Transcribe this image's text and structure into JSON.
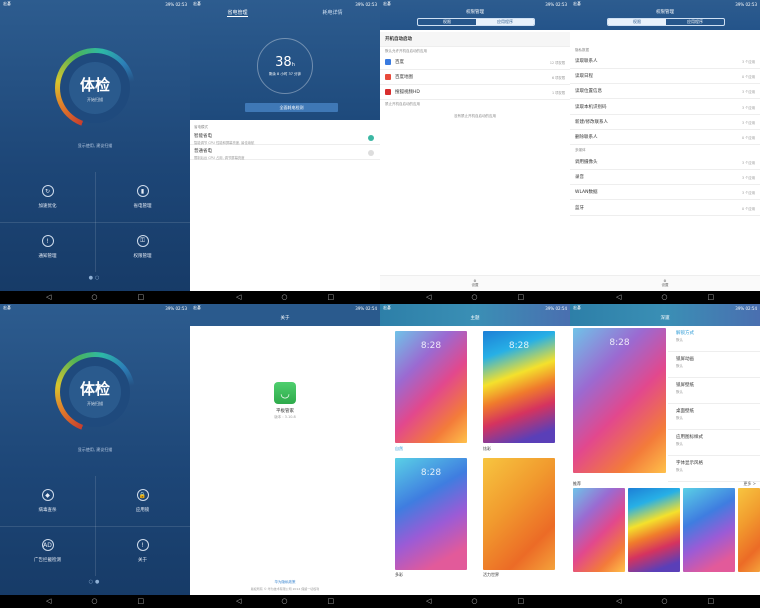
{
  "status": {
    "time": "02:53",
    "time2": "02:54",
    "carrier": "宏碁",
    "battery": "39%"
  },
  "home1": {
    "title": "体检",
    "subtitle": "开始扫描",
    "hint": "显示使用, 建议扫描",
    "items": [
      {
        "label": "加速优化",
        "icon": "↻"
      },
      {
        "label": "省电管理",
        "icon": "▮"
      },
      {
        "label": "通知管理",
        "icon": "!"
      },
      {
        "label": "权限管理",
        "icon": "⚿"
      }
    ]
  },
  "home2": {
    "title": "体检",
    "subtitle": "开始扫描",
    "hint": "显示使用, 建议扫描",
    "items": [
      {
        "label": "病毒查杀",
        "icon": "◆"
      },
      {
        "label": "应用锁",
        "icon": "🔒"
      },
      {
        "label": "广告拦截检测",
        "icon": "AD"
      },
      {
        "label": "关于",
        "icon": "!"
      }
    ]
  },
  "power": {
    "tab1": "省电管理",
    "tab2": "耗电详情",
    "hours": "38",
    "unit": "h",
    "remain": "剩余 8 小时 37 分钟",
    "button": "全面耗电检测",
    "modes_header": "省电模式",
    "modes": [
      {
        "name": "智能省电",
        "detail": "智能调节 CPU 性能和屏幕亮度, 最佳续航"
      },
      {
        "name": "普通省电",
        "detail": "限制后台 CPU 占用, 调节屏幕亮度"
      }
    ]
  },
  "perm1": {
    "title": "权限管理",
    "tab_a": "权限",
    "tab_b": "应用程序",
    "section": "开机自动启动",
    "sub": "默认允许开机自启动的应用",
    "apps": [
      {
        "name": "百度",
        "count": "12 项权限",
        "color": "#3a7be0"
      },
      {
        "name": "百度地图",
        "count": "6 项权限",
        "color": "#e84a3a"
      },
      {
        "name": "搜狐视频HD",
        "count": "1 项权限",
        "color": "#d82e2e"
      }
    ],
    "sub2": "禁止开机自启动的应用",
    "empty": "没有禁止开机自启动的应用",
    "settings": "设置"
  },
  "perm2": {
    "title": "权限管理",
    "tab_a": "权限",
    "tab_b": "应用程序",
    "h1": "隐私数据",
    "rows1": [
      {
        "name": "读取联系人",
        "v": "3 个应用"
      },
      {
        "name": "读取日程",
        "v": "0 个应用"
      },
      {
        "name": "读取位置信息",
        "v": "3 个应用"
      },
      {
        "name": "读取本机识别码",
        "v": "3 个应用"
      },
      {
        "name": "新建/修改联系人",
        "v": "3 个应用"
      },
      {
        "name": "删除联系人",
        "v": "0 个应用"
      }
    ],
    "h2": "多媒体",
    "rows2": [
      {
        "name": "调用摄像头",
        "v": "3 个应用"
      },
      {
        "name": "录音",
        "v": "3 个应用"
      },
      {
        "name": "WLAN数据",
        "v": "3 个应用"
      },
      {
        "name": "蓝牙",
        "v": "0 个应用"
      }
    ],
    "settings": "设置"
  },
  "about": {
    "title": "关于",
    "app": "平板管家",
    "version": "版本 : 3.10.8",
    "link": "华为隐私政策",
    "copyright": "版权所有 © 华为技术有限公司 2014 保留一切权利"
  },
  "themes": {
    "title": "主题",
    "items": [
      {
        "name": "自然"
      },
      {
        "name": "炫彩"
      },
      {
        "name": "多彩"
      },
      {
        "name": "活力世界"
      }
    ],
    "clock": "8:28"
  },
  "detail": {
    "title": "深邃",
    "menu": [
      {
        "a": "解锁方式",
        "b": "默认"
      },
      {
        "a": "锁屏动画",
        "b": "默认"
      },
      {
        "a": "锁屏壁纸",
        "b": "默认"
      },
      {
        "a": "桌面壁纸",
        "b": "默认"
      },
      {
        "a": "应用图标样式",
        "b": "默认"
      },
      {
        "a": "字体显示风格",
        "b": "默认"
      }
    ],
    "rec": "推荐",
    "more": "更多 >"
  }
}
